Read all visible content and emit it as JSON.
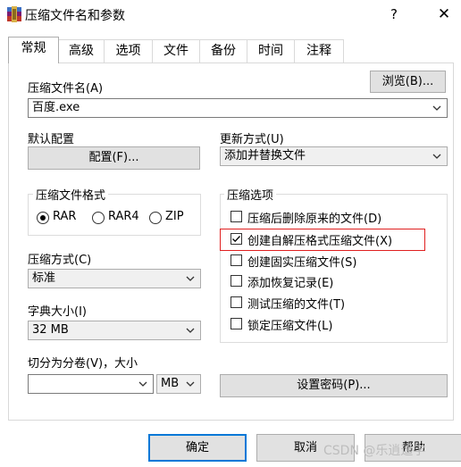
{
  "window": {
    "title": "压缩文件名和参数",
    "help": "?",
    "close": "✕"
  },
  "tabs": [
    {
      "label": "常规"
    },
    {
      "label": "高级"
    },
    {
      "label": "选项"
    },
    {
      "label": "文件"
    },
    {
      "label": "备份"
    },
    {
      "label": "时间"
    },
    {
      "label": "注释"
    }
  ],
  "archive_name": {
    "label": "压缩文件名(A)",
    "browse_label": "浏览(B)...",
    "value": "百度.exe"
  },
  "default_profile": {
    "label": "默认配置",
    "button_label": "配置(F)..."
  },
  "update_mode": {
    "label": "更新方式(U)",
    "value": "添加并替换文件"
  },
  "archive_format": {
    "label": "压缩文件格式",
    "options": [
      "RAR",
      "RAR4",
      "ZIP"
    ],
    "selected": "RAR"
  },
  "archive_options": {
    "label": "压缩选项",
    "items": [
      {
        "label": "压缩后删除原来的文件(D)",
        "checked": false
      },
      {
        "label": "创建自解压格式压缩文件(X)",
        "checked": true
      },
      {
        "label": "创建固实压缩文件(S)",
        "checked": false
      },
      {
        "label": "添加恢复记录(E)",
        "checked": false
      },
      {
        "label": "测试压缩的文件(T)",
        "checked": false
      },
      {
        "label": "锁定压缩文件(L)",
        "checked": false
      }
    ]
  },
  "compression_method": {
    "label": "压缩方式(C)",
    "value": "标准"
  },
  "dictionary_size": {
    "label": "字典大小(I)",
    "value": "32 MB"
  },
  "split_volumes": {
    "label": "切分为分卷(V)，大小",
    "value": "",
    "unit": "MB"
  },
  "set_password": {
    "label": "设置密码(P)..."
  },
  "buttons": {
    "ok": "确定",
    "cancel": "取消",
    "help": "帮助"
  },
  "watermark": "CSDN @乐逍遥学",
  "colors": {
    "accent": "#0078d7",
    "highlight": "#e02020"
  }
}
